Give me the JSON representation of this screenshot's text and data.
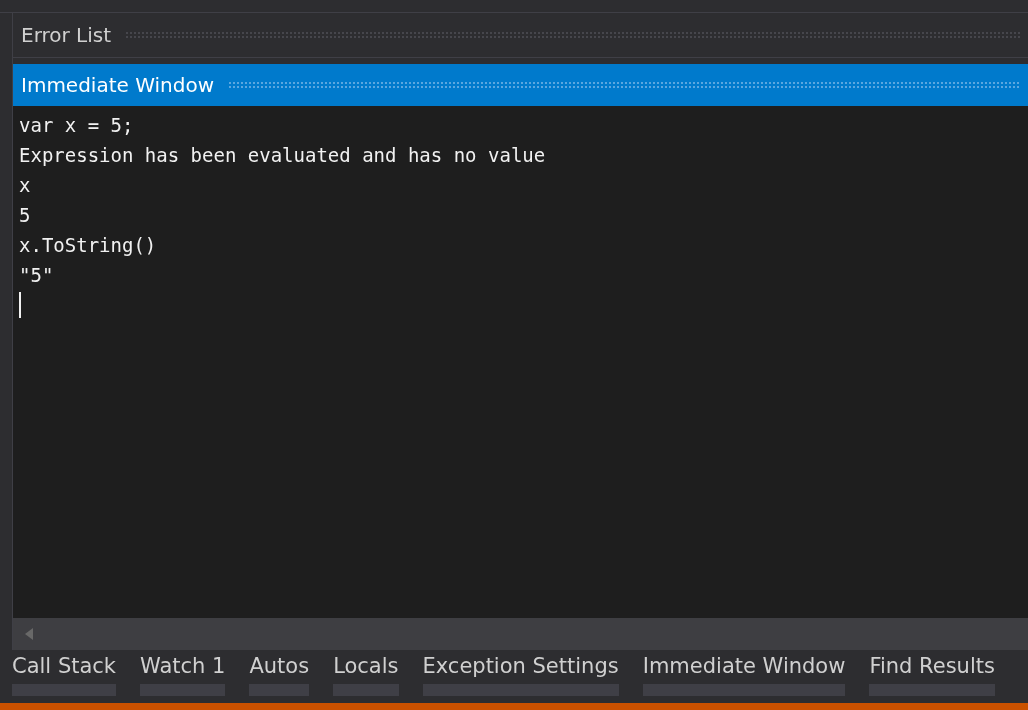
{
  "panels": [
    {
      "title": "Error List",
      "active": false
    },
    {
      "title": "Immediate Window",
      "active": true
    }
  ],
  "immediate_lines": [
    "var x = 5;",
    "Expression has been evaluated and has no value",
    "x",
    "5",
    "x.ToString()",
    "\"5\""
  ],
  "tabs": [
    {
      "label": "Call Stack",
      "selected": false
    },
    {
      "label": "Watch 1",
      "selected": false
    },
    {
      "label": "Autos",
      "selected": false
    },
    {
      "label": "Locals",
      "selected": false
    },
    {
      "label": "Exception Settings",
      "selected": false
    },
    {
      "label": "Immediate Window",
      "selected": false
    },
    {
      "label": "Find Results",
      "selected": false
    }
  ]
}
